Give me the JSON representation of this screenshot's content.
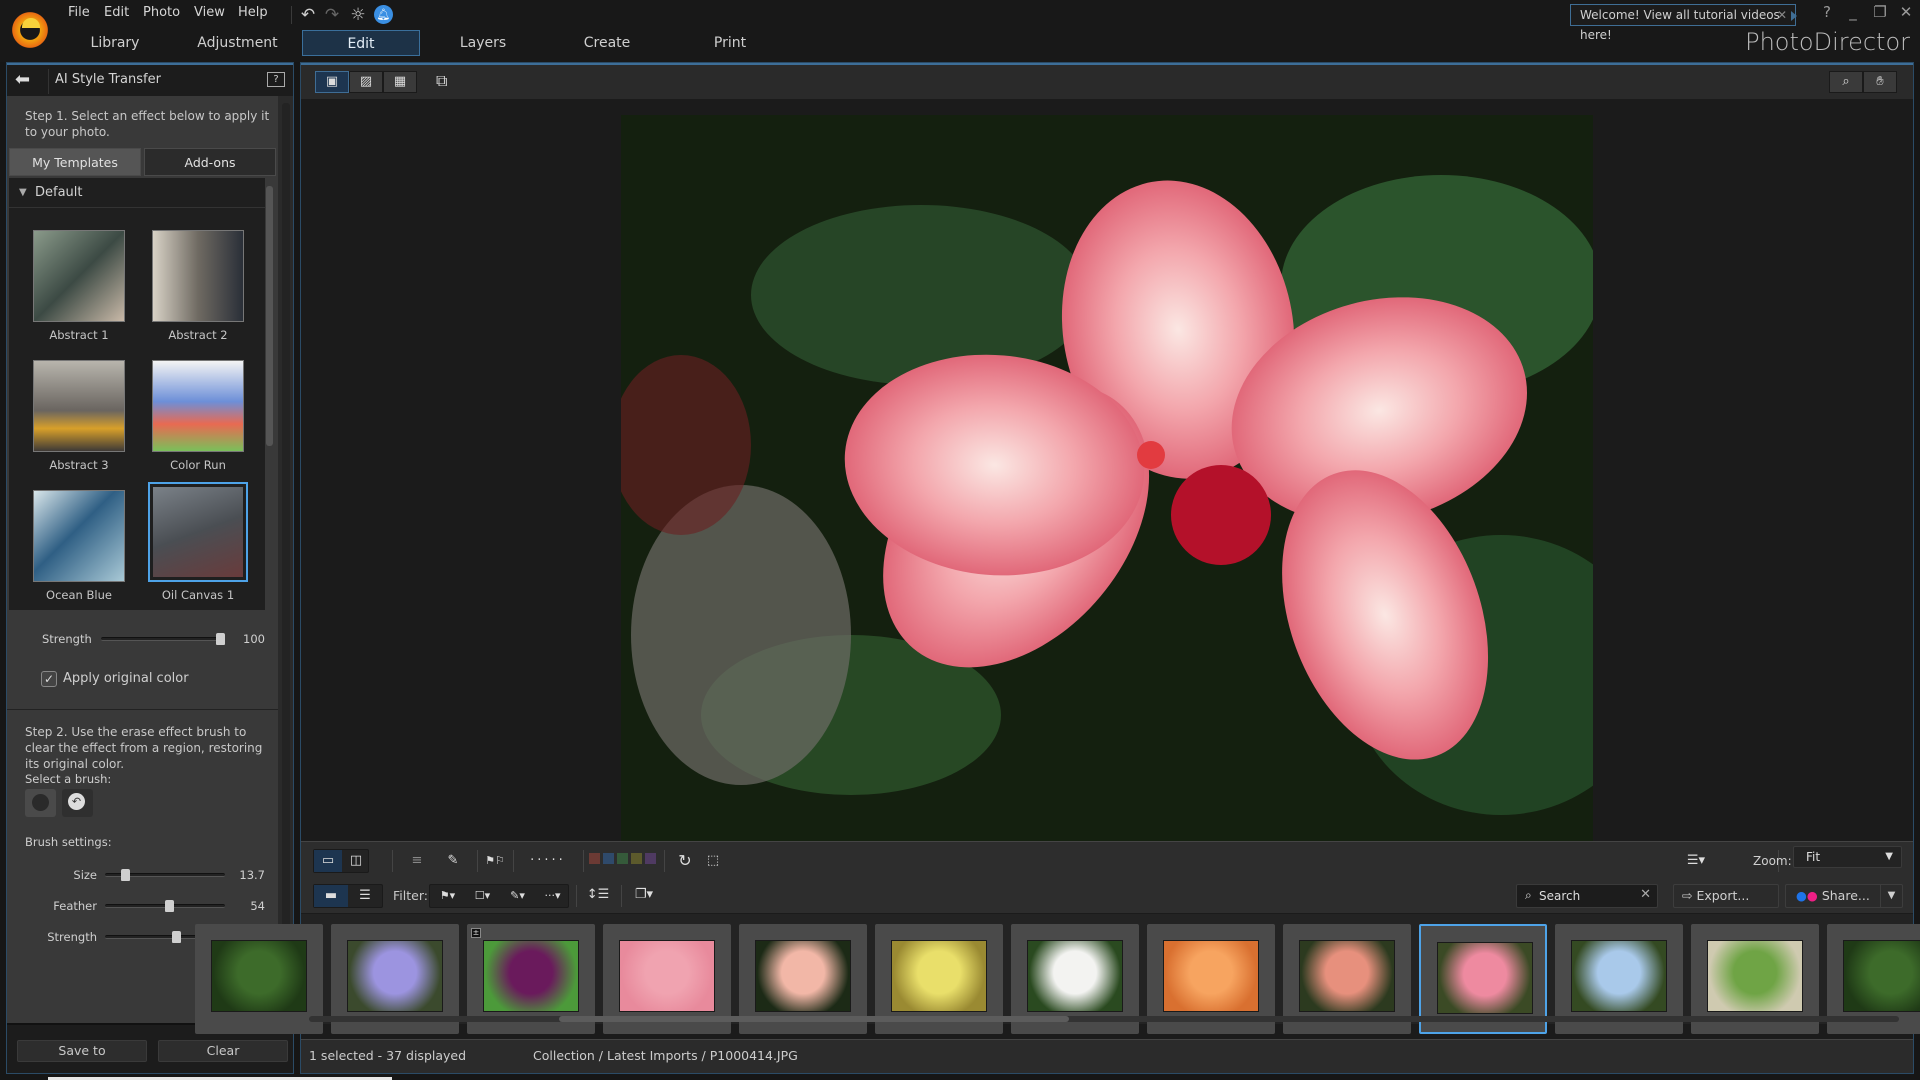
{
  "app": {
    "brand": "PhotoDirector",
    "menu": [
      "File",
      "Edit",
      "Photo",
      "View",
      "Help"
    ],
    "toolbar_icons": [
      "undo-icon",
      "redo-icon",
      "settings-icon",
      "notification-bell-icon"
    ],
    "module_tabs": [
      {
        "label": "Library",
        "active": false
      },
      {
        "label": "Adjustment",
        "active": false
      },
      {
        "label": "Edit",
        "active": true
      },
      {
        "label": "Layers",
        "active": false
      },
      {
        "label": "Create",
        "active": false
      },
      {
        "label": "Print",
        "active": false
      }
    ],
    "welcome_tooltip": "Welcome! View all tutorial videos here!",
    "window_controls": [
      "?",
      "_",
      "❐",
      "✕"
    ]
  },
  "panel": {
    "title": "AI Style Transfer",
    "step1": "Step 1. Select an effect below to apply it to your photo.",
    "tabs": [
      {
        "label": "My Templates",
        "active": true
      },
      {
        "label": "Add-ons",
        "active": false
      }
    ],
    "group": "Default",
    "templates": [
      {
        "name": "Abstract 1",
        "selected": false
      },
      {
        "name": "Abstract 2",
        "selected": false
      },
      {
        "name": "Abstract 3",
        "selected": false
      },
      {
        "name": "Color Run",
        "selected": false
      },
      {
        "name": "Ocean Blue",
        "selected": false
      },
      {
        "name": "Oil Canvas 1",
        "selected": true
      }
    ],
    "strength_label": "Strength",
    "strength_value": "100",
    "strength_fraction": 1.0,
    "apply_original_color_label": "Apply original color",
    "apply_original_color_checked": true,
    "step2": "Step 2. Use the erase effect brush to clear the effect from a region, restoring its original color.",
    "select_brush_label": "Select a brush:",
    "brushes": [
      "round-brush-icon",
      "erase-brush-icon"
    ],
    "brush_settings_label": "Brush settings:",
    "brush_settings": [
      {
        "label": "Size",
        "value": "13.7",
        "fraction": 0.14
      },
      {
        "label": "Feather",
        "value": "54",
        "fraction": 0.54
      },
      {
        "label": "Strength",
        "value": "60",
        "fraction": 0.6
      }
    ],
    "save_label": "Save to",
    "clear_label": "Clear"
  },
  "viewer": {
    "view_modes": [
      "viewer-filmstrip-icon",
      "viewer-single-icon",
      "grid-icon"
    ],
    "active_view": 0,
    "tools": [
      "zoom-tool-icon",
      "hand-tool-icon"
    ],
    "zoom_label": "Zoom:",
    "zoom_value": "Fit",
    "filter_label": "Filter:",
    "search_placeholder": "Search",
    "export_label": "Export...",
    "share_label": "Share...",
    "color_labels": [
      "#6b3a34",
      "#2f4a6b",
      "#355a3a",
      "#5c5a2c",
      "#4f3a62"
    ]
  },
  "filmstrip": {
    "items": [
      {
        "colors": [
          "#3d6b2a",
          "#1f3a16"
        ],
        "selected": false,
        "partial": true
      },
      {
        "colors": [
          "#9c94e0",
          "#3b4a2d"
        ],
        "selected": false
      },
      {
        "colors": [
          "#6a1a5c",
          "#4c9a3a"
        ],
        "selected": false,
        "badge": true
      },
      {
        "colors": [
          "#f0a3b0",
          "#e88a9c"
        ],
        "selected": false
      },
      {
        "colors": [
          "#f2b7a7",
          "#1c2a16"
        ],
        "selected": false
      },
      {
        "colors": [
          "#e9df6a",
          "#9a8a32"
        ],
        "selected": false
      },
      {
        "colors": [
          "#f3f3f1",
          "#2a4a20"
        ],
        "selected": false
      },
      {
        "colors": [
          "#f7a460",
          "#d97030"
        ],
        "selected": false
      },
      {
        "colors": [
          "#e7907d",
          "#2c3a1f"
        ],
        "selected": false
      },
      {
        "colors": [
          "#ee8aa0",
          "#3b4a25"
        ],
        "selected": true
      },
      {
        "colors": [
          "#a9c9ea",
          "#344a22"
        ],
        "selected": false
      },
      {
        "colors": [
          "#6fa445",
          "#cfcab0"
        ],
        "selected": false
      },
      {
        "colors": [
          "#3d6b2a",
          "#1f3a16"
        ],
        "selected": false,
        "partial": true
      }
    ]
  },
  "status": {
    "selection": "1 selected - 37 displayed",
    "path": "Collection / Latest Imports / P1000414.JPG"
  }
}
